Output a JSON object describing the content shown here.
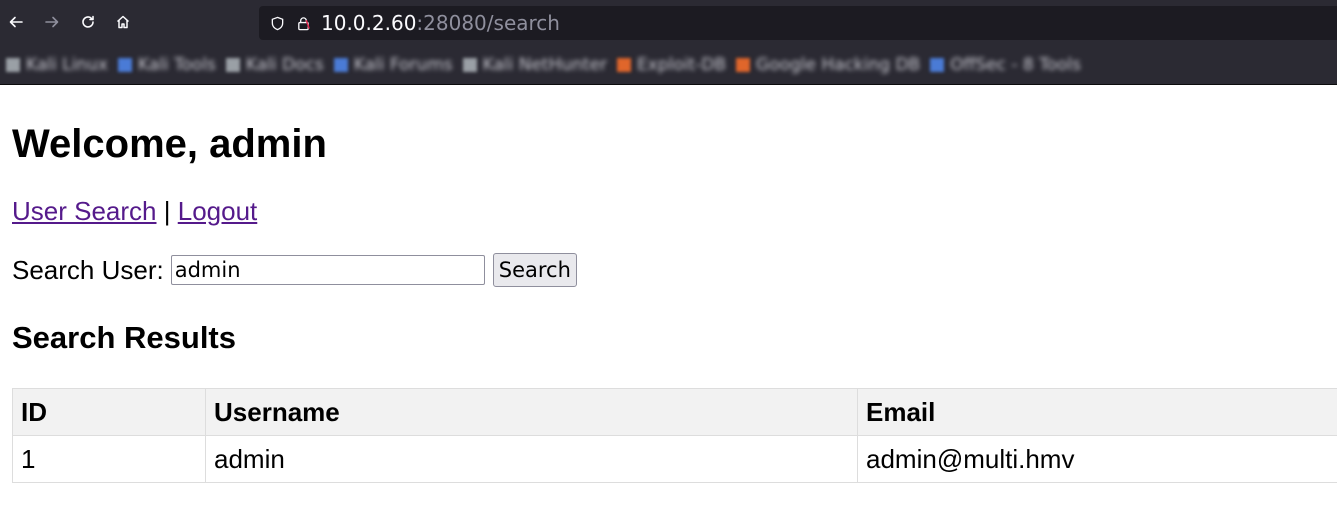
{
  "browser": {
    "url_host": "10.0.2.60",
    "url_rest": ":28080/search",
    "icons": {
      "back": "back-arrow-icon",
      "forward": "forward-arrow-icon",
      "reload": "reload-icon",
      "home": "home-icon",
      "shield": "shield-icon",
      "lock": "lock-icon"
    },
    "bookmarks": [
      {
        "label": "Kali Linux",
        "color": "#9aa0a6"
      },
      {
        "label": "Kali Tools",
        "color": "#4a7bd6"
      },
      {
        "label": "Kali Docs",
        "color": "#9aa0a6"
      },
      {
        "label": "Kali Forums",
        "color": "#4a7bd6"
      },
      {
        "label": "Kali NetHunter",
        "color": "#9aa0a6"
      },
      {
        "label": "Exploit-DB",
        "color": "#e0662b"
      },
      {
        "label": "Google Hacking DB",
        "color": "#e0662b"
      },
      {
        "label": "OffSec - 8 Tools",
        "color": "#4a7bd6"
      }
    ]
  },
  "page": {
    "heading": "Welcome, admin",
    "nav": {
      "search_link": "User Search",
      "separator": "|",
      "logout_link": "Logout"
    },
    "search": {
      "label": "Search User:",
      "value": "admin",
      "button": "Search"
    },
    "results_heading": "Search Results",
    "table": {
      "headers": [
        "ID",
        "Username",
        "Email"
      ],
      "rows": [
        [
          "1",
          "admin",
          "admin@multi.hmv"
        ]
      ]
    }
  },
  "colors": {
    "chrome_bg": "#2b2a33",
    "urlbar_bg": "#1c1b22",
    "link_visited": "#551a8b",
    "table_header_bg": "#f2f2f2"
  }
}
